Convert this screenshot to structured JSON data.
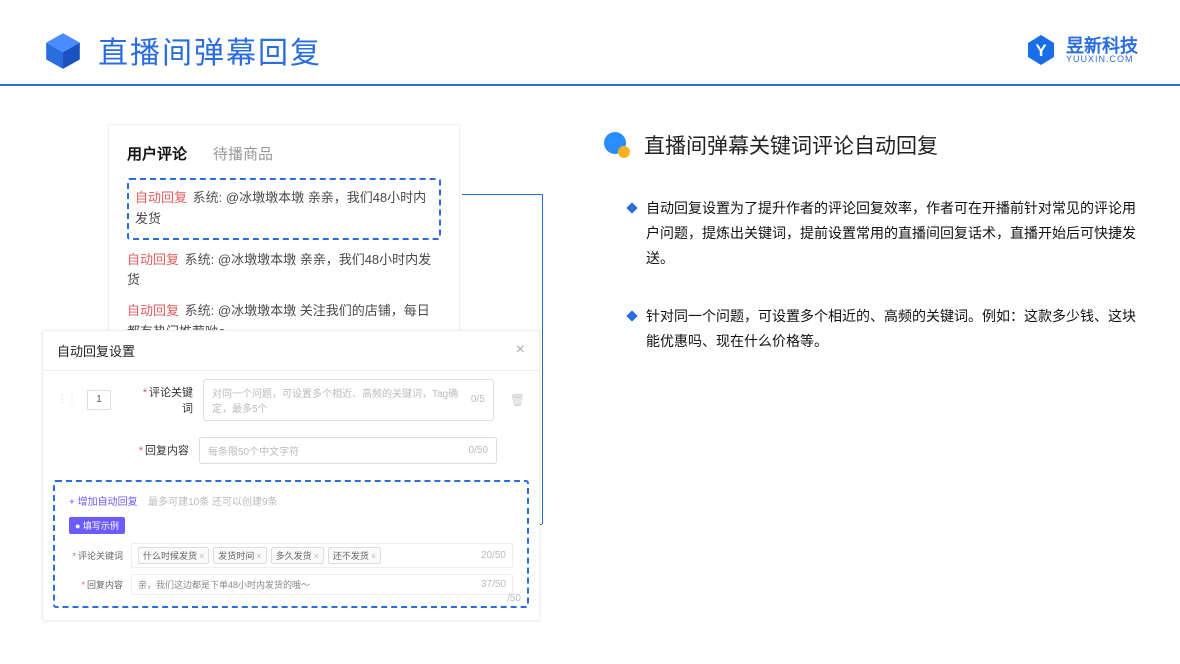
{
  "header": {
    "title": "直播间弹幕回复",
    "brand_cn": "昱新科技",
    "brand_en": "YUUXIN.COM"
  },
  "tabs": {
    "active": "用户评论",
    "inactive": "待播商品"
  },
  "comments": {
    "highlighted": {
      "tag": "自动回复",
      "sys": "系统:",
      "text": "@冰墩墩本墩 亲亲，我们48小时内发货"
    },
    "c2": {
      "tag": "自动回复",
      "sys": "系统:",
      "text": "@冰墩墩本墩 亲亲，我们48小时内发货"
    },
    "c3": {
      "tag": "自动回复",
      "sys": "系统:",
      "text": "@冰墩墩本墩 关注我们的店铺，每日都有热门推荐呦～"
    }
  },
  "modal": {
    "title": "自动回复设置",
    "num": "1",
    "row1": {
      "label": "评论关键词",
      "placeholder": "对同一个问题，可设置多个相近、高频的关键词，Tag确定，最多5个",
      "count": "0/5"
    },
    "row2": {
      "label": "回复内容",
      "placeholder": "每条限50个中文字符",
      "count": "0/50"
    },
    "add": "+ 增加自动回复",
    "add_hint": "最多可建10条 还可以创建9条",
    "example_tag": "● 填写示例",
    "ex1": {
      "label": "评论关键词",
      "tags": [
        "什么时候发货",
        "发货时间",
        "多久发货",
        "还不发货"
      ],
      "count": "20/50"
    },
    "ex2": {
      "label": "回复内容",
      "text": "亲，我们这边都是下单48小时内发货的哦～",
      "count": "37/50"
    },
    "float_count": "/50"
  },
  "right": {
    "title": "直播间弹幕关键词评论自动回复",
    "b1": "自动回复设置为了提升作者的评论回复效率，作者可在开播前针对常见的评论用户问题，提炼出关键词，提前设置常用的直播间回复话术，直播开始后可快捷发送。",
    "b2": "针对同一个问题，可设置多个相近的、高频的关键词。例如：这款多少钱、这块能优惠吗、现在什么价格等。"
  }
}
